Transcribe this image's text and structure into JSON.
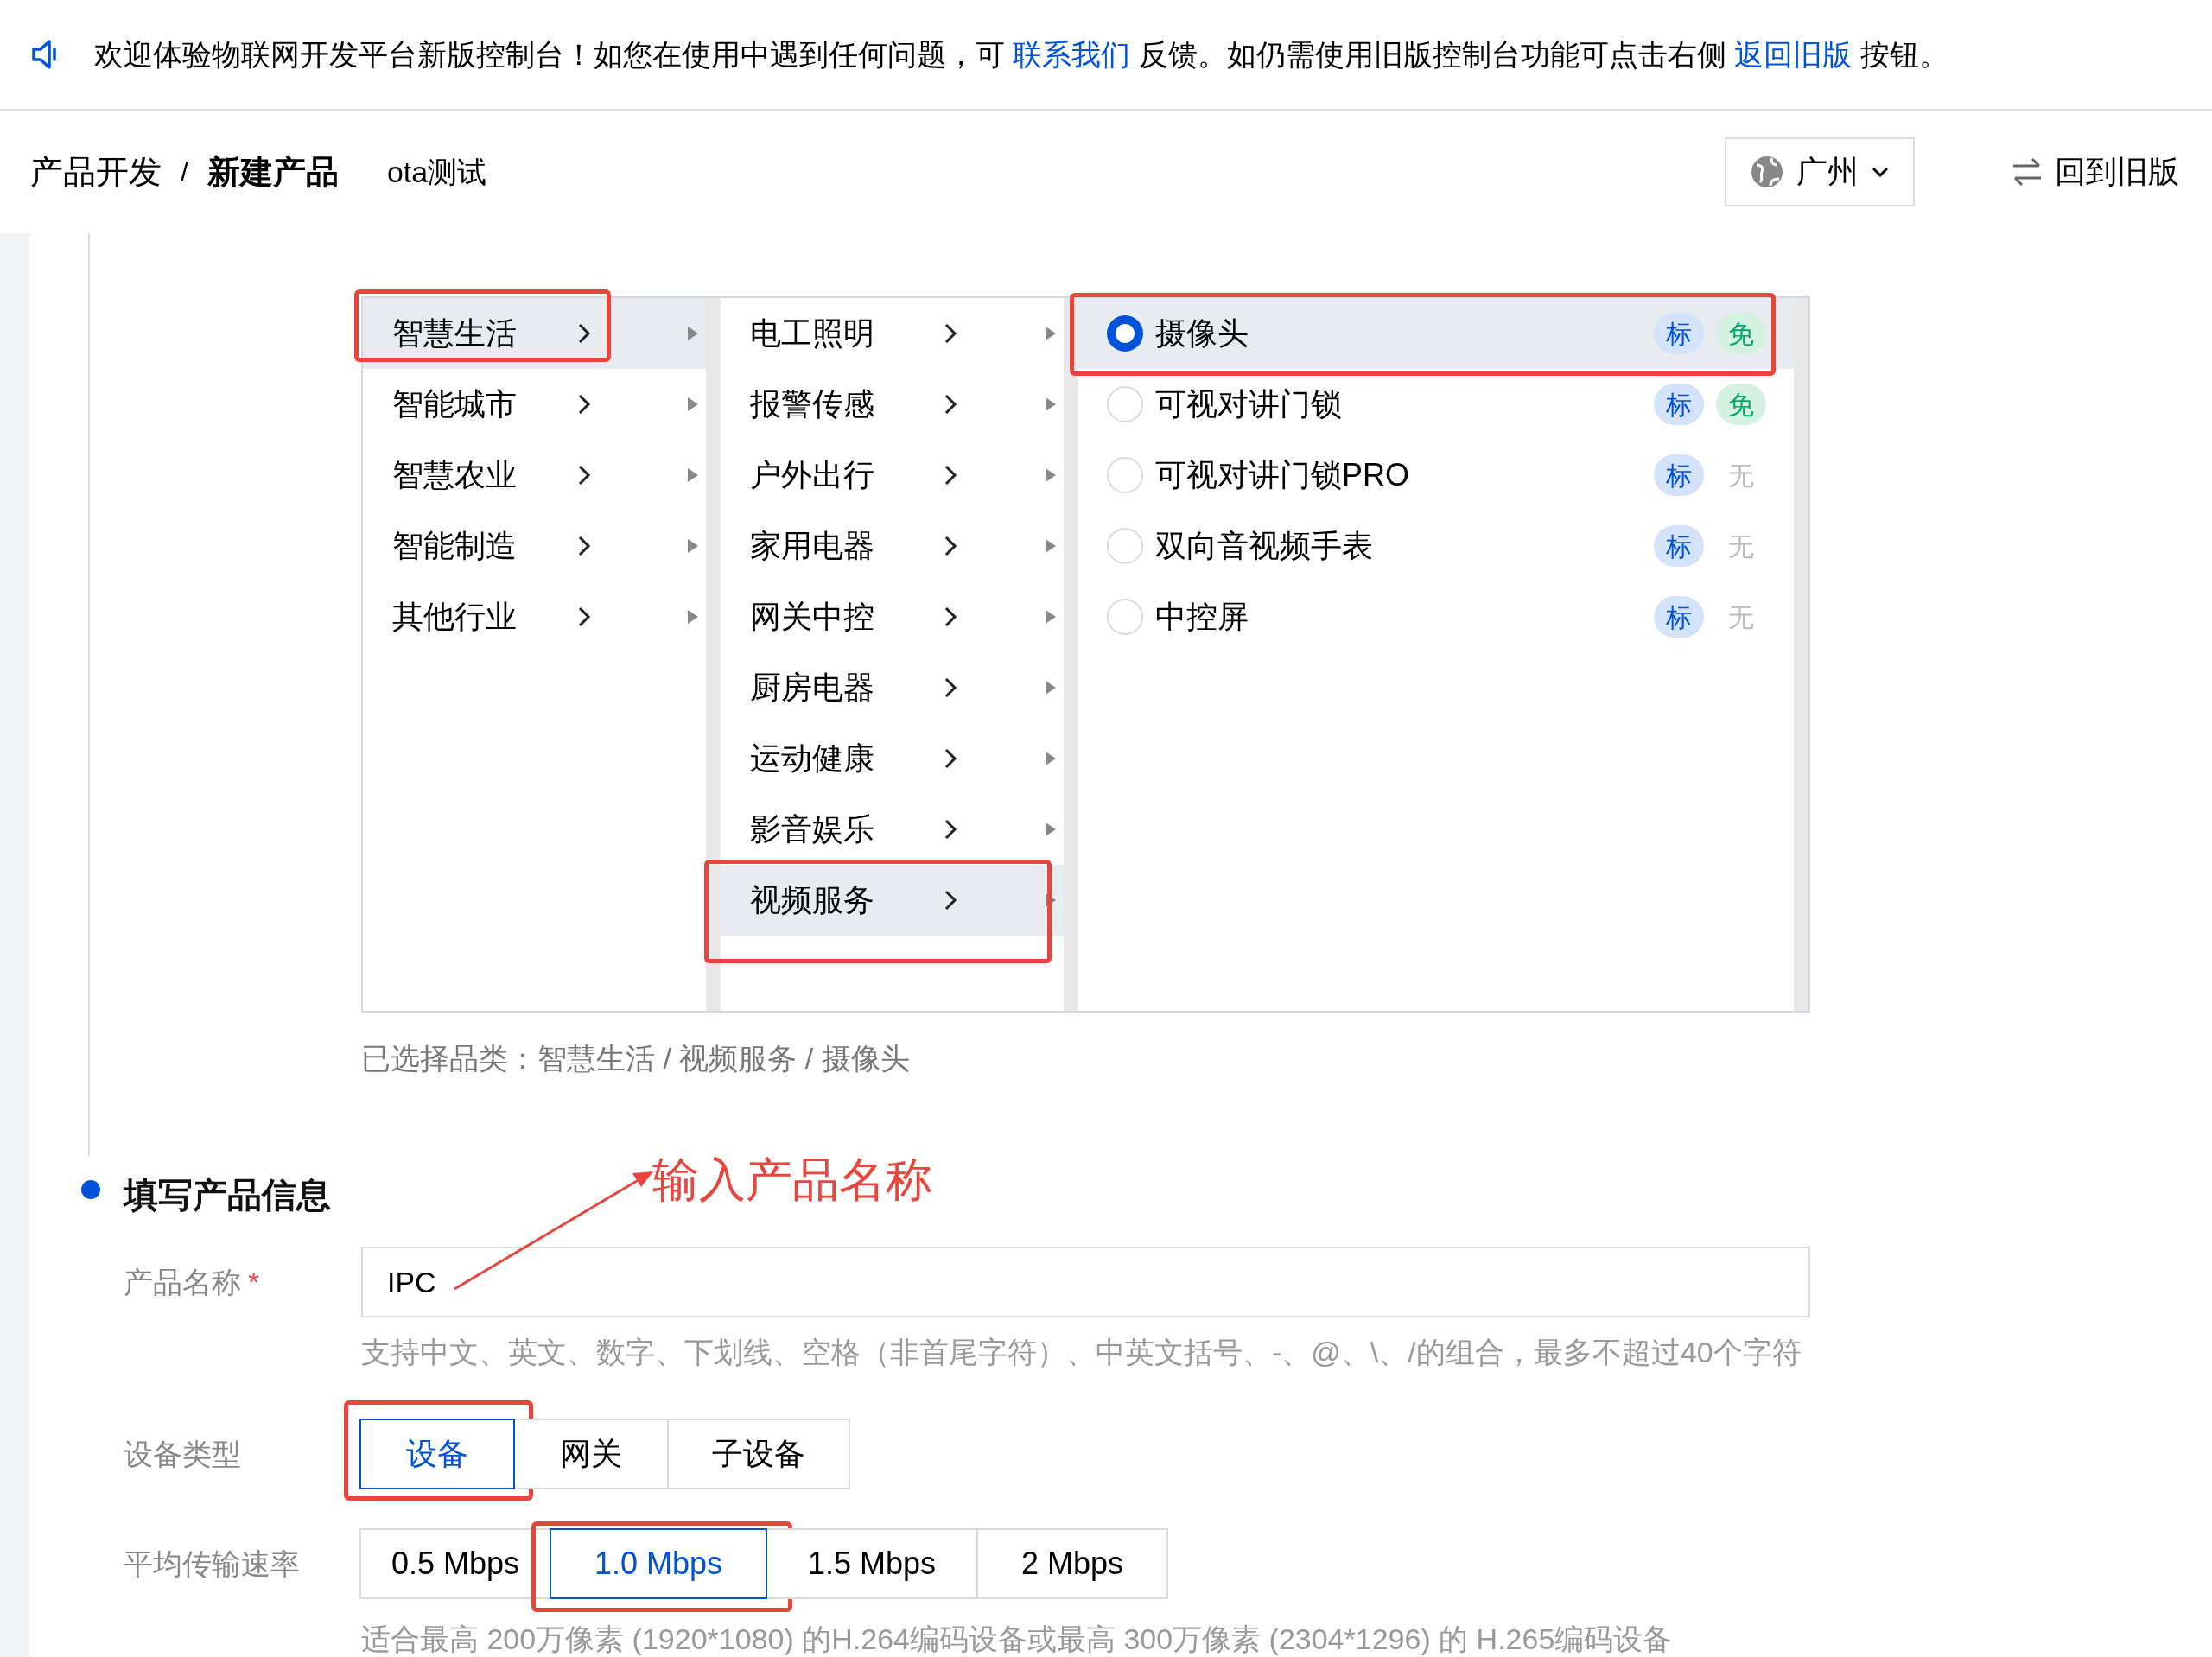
{
  "banner": {
    "parts": [
      {
        "kind": "text",
        "text": "欢迎体验物联网开发平台新版控制台！如您在使用中遇到任何问题，可 "
      },
      {
        "kind": "link",
        "text": "联系我们"
      },
      {
        "kind": "text",
        "text": " 反馈。如仍需使用旧版控制台功能可点击右侧 "
      },
      {
        "kind": "link",
        "text": "返回旧版"
      },
      {
        "kind": "text",
        "text": " 按钮。"
      }
    ]
  },
  "header": {
    "breadcrumb": [
      {
        "label": "产品开发",
        "current": false
      },
      {
        "label": "新建产品",
        "current": true
      }
    ],
    "separator": "/",
    "project": "ota测试",
    "region": "广州",
    "switch_label": "回到旧版"
  },
  "cascader": {
    "columns": [
      {
        "items": [
          {
            "label": "智慧生活",
            "selected": true,
            "highlighted": true
          },
          {
            "label": "智能城市",
            "selected": false,
            "highlighted": false
          },
          {
            "label": "智慧农业",
            "selected": false,
            "highlighted": false
          },
          {
            "label": "智能制造",
            "selected": false,
            "highlighted": false
          },
          {
            "label": "其他行业",
            "selected": false,
            "highlighted": false
          }
        ]
      },
      {
        "items": [
          {
            "label": "电工照明",
            "selected": false,
            "highlighted": false
          },
          {
            "label": "报警传感",
            "selected": false,
            "highlighted": false
          },
          {
            "label": "户外出行",
            "selected": false,
            "highlighted": false
          },
          {
            "label": "家用电器",
            "selected": false,
            "highlighted": false
          },
          {
            "label": "网关中控",
            "selected": false,
            "highlighted": false
          },
          {
            "label": "厨房电器",
            "selected": false,
            "highlighted": false
          },
          {
            "label": "运动健康",
            "selected": false,
            "highlighted": false
          },
          {
            "label": "影音娱乐",
            "selected": false,
            "highlighted": false
          },
          {
            "label": "视频服务",
            "selected": true,
            "highlighted": true
          }
        ]
      }
    ],
    "options": [
      {
        "label": "摄像头",
        "selected": true,
        "highlighted": true,
        "tags": [
          {
            "text": "标",
            "kind": "standard"
          },
          {
            "text": "免",
            "kind": "free"
          }
        ]
      },
      {
        "label": "可视对讲门锁",
        "selected": false,
        "highlighted": false,
        "tags": [
          {
            "text": "标",
            "kind": "standard"
          },
          {
            "text": "免",
            "kind": "free"
          }
        ]
      },
      {
        "label": "可视对讲门锁PRO",
        "selected": false,
        "highlighted": false,
        "tags": [
          {
            "text": "标",
            "kind": "standard"
          },
          {
            "text": "无",
            "kind": "none"
          }
        ]
      },
      {
        "label": "双向音视频手表",
        "selected": false,
        "highlighted": false,
        "tags": [
          {
            "text": "标",
            "kind": "standard"
          },
          {
            "text": "无",
            "kind": "none"
          }
        ]
      },
      {
        "label": "中控屏",
        "selected": false,
        "highlighted": false,
        "tags": [
          {
            "text": "标",
            "kind": "standard"
          },
          {
            "text": "无",
            "kind": "none"
          }
        ]
      }
    ],
    "selected_path": "已选择品类：智慧生活 / 视频服务 / 摄像头"
  },
  "product_info": {
    "title": "填写产品信息",
    "name_field": {
      "label": "产品名称",
      "required_mark": "*",
      "value": "IPC",
      "hint": "支持中文、英文、数字、下划线、空格（非首尾字符）、中英文括号、-、@、\\、/的组合，最多不超过40个字符"
    },
    "device_type": {
      "label": "设备类型",
      "options": [
        {
          "label": "设备",
          "selected": true,
          "highlighted": true
        },
        {
          "label": "网关",
          "selected": false,
          "highlighted": false
        },
        {
          "label": "子设备",
          "selected": false,
          "highlighted": false
        }
      ]
    },
    "bitrate": {
      "label": "平均传输速率",
      "options": [
        {
          "label": "0.5 Mbps",
          "selected": false,
          "highlighted": false
        },
        {
          "label": "1.0 Mbps",
          "selected": true,
          "highlighted": true
        },
        {
          "label": "1.5 Mbps",
          "selected": false,
          "highlighted": false
        },
        {
          "label": "2 Mbps",
          "selected": false,
          "highlighted": false
        }
      ],
      "hint": "适合最高 200万像素 (1920*1080) 的H.264编码设备或最高 300万像素 (2304*1296) 的 H.265编码设备"
    }
  },
  "annotation": {
    "callout": "输入产品名称"
  }
}
